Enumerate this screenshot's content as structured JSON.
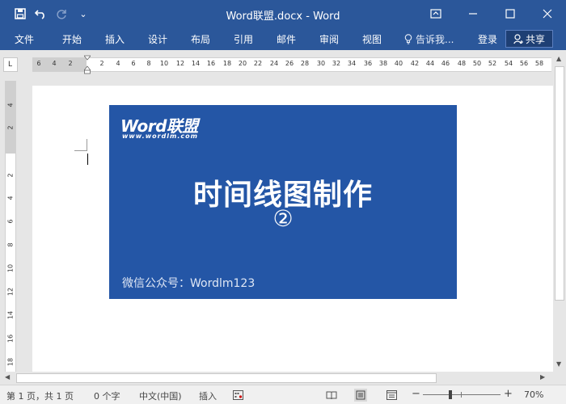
{
  "app": {
    "window_title": "Word联盟.docx - Word"
  },
  "quick_access": {
    "customize_glyph": "⌄"
  },
  "ribbon": {
    "tabs": [
      {
        "label": "文件"
      },
      {
        "label": "开始"
      },
      {
        "label": "插入"
      },
      {
        "label": "设计"
      },
      {
        "label": "布局"
      },
      {
        "label": "引用"
      },
      {
        "label": "邮件"
      },
      {
        "label": "审阅"
      },
      {
        "label": "视图"
      }
    ],
    "tell_me": "告诉我...",
    "login": "登录",
    "share": "共享"
  },
  "ruler": {
    "corner": "L",
    "left_ticks": [
      "6",
      "4",
      "2"
    ],
    "ticks": [
      "2",
      "4",
      "6",
      "8",
      "10",
      "12",
      "14",
      "16",
      "18",
      "20",
      "22",
      "24",
      "26",
      "28",
      "30",
      "32",
      "34",
      "36",
      "38",
      "40",
      "42",
      "44",
      "46",
      "48",
      "50",
      "52",
      "54",
      "56",
      "58"
    ],
    "vertical_ticks": [
      "4",
      "2",
      "2",
      "4",
      "6",
      "8",
      "10",
      "12",
      "14",
      "16",
      "18"
    ]
  },
  "document": {
    "banner": {
      "logo": "Word联盟",
      "url": "www.wordlm.com",
      "title": "时间线图制作",
      "number": "②",
      "wechat": "微信公众号：Wordlm123",
      "color": "#2456a6"
    }
  },
  "status": {
    "page": "第 1 页，共 1 页",
    "words": "0 个字",
    "language": "中文(中国)",
    "mode": "插入",
    "zoom_minus": "−",
    "zoom_plus": "+",
    "zoom": "70%",
    "zoom_fraction": 0.35
  },
  "colors": {
    "accent": "#2b579a"
  }
}
